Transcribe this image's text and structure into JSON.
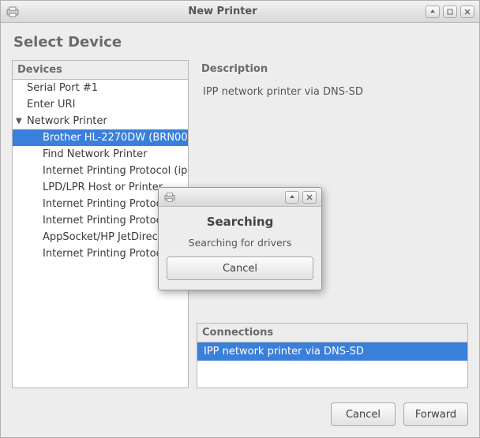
{
  "window": {
    "title": "New Printer"
  },
  "page": {
    "heading": "Select Device"
  },
  "devices": {
    "label": "Devices",
    "items": [
      {
        "label": "Serial Port #1"
      },
      {
        "label": "Enter URI"
      }
    ],
    "network_group": {
      "label": "Network Printer",
      "items": [
        {
          "label": "Brother HL-2270DW (BRN001",
          "selected": true
        },
        {
          "label": "Find Network Printer"
        },
        {
          "label": "Internet Printing Protocol (ipp"
        },
        {
          "label": "LPD/LPR Host or Printer"
        },
        {
          "label": "Internet Printing Protoco"
        },
        {
          "label": "Internet Printing Protoco"
        },
        {
          "label": "AppSocket/HP JetDirect"
        },
        {
          "label": "Internet Printing Protoco"
        }
      ]
    }
  },
  "description": {
    "label": "Description",
    "text": "IPP network printer via DNS-SD"
  },
  "connections": {
    "label": "Connections",
    "items": [
      {
        "label": "IPP network printer via DNS-SD",
        "selected": true
      }
    ]
  },
  "footer": {
    "cancel": "Cancel",
    "forward": "Forward"
  },
  "modal": {
    "title": "Searching",
    "message": "Searching for drivers",
    "cancel": "Cancel"
  }
}
